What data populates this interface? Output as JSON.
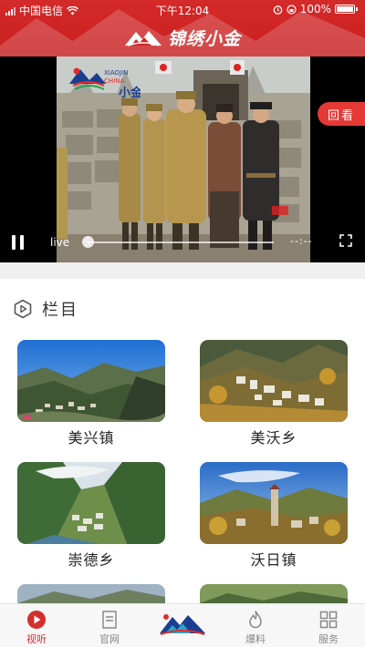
{
  "status_bar": {
    "carrier": "中国电信",
    "time": "下午12:04",
    "battery": "100%",
    "icons": [
      "signal-icon",
      "wifi-icon",
      "alarm-icon",
      "battery-icon"
    ]
  },
  "header": {
    "title": "锦绣小金",
    "logo": "mountain-logo-icon",
    "color": "#cf2525"
  },
  "video": {
    "badge": "回看",
    "live_label": "live",
    "time": "--:--",
    "logo_text": "XIAOJIN CHINA 小金",
    "progress": 0,
    "controls": [
      "pause-icon",
      "fullscreen-icon"
    ]
  },
  "section": {
    "title": "栏目",
    "icon": "play-circle-icon"
  },
  "cards": [
    {
      "label": "美兴镇"
    },
    {
      "label": "美沃乡"
    },
    {
      "label": "崇德乡"
    },
    {
      "label": "沃日镇"
    }
  ],
  "tabbar": {
    "accent": "#d32f2f",
    "items": [
      {
        "label": "视听",
        "icon": "play-icon",
        "active": true
      },
      {
        "label": "官网",
        "icon": "document-icon",
        "active": false
      },
      {
        "label": "",
        "icon": "mountain-logo-icon",
        "active": false
      },
      {
        "label": "爆料",
        "icon": "flame-icon",
        "active": false
      },
      {
        "label": "服务",
        "icon": "grid-icon",
        "active": false
      }
    ]
  }
}
